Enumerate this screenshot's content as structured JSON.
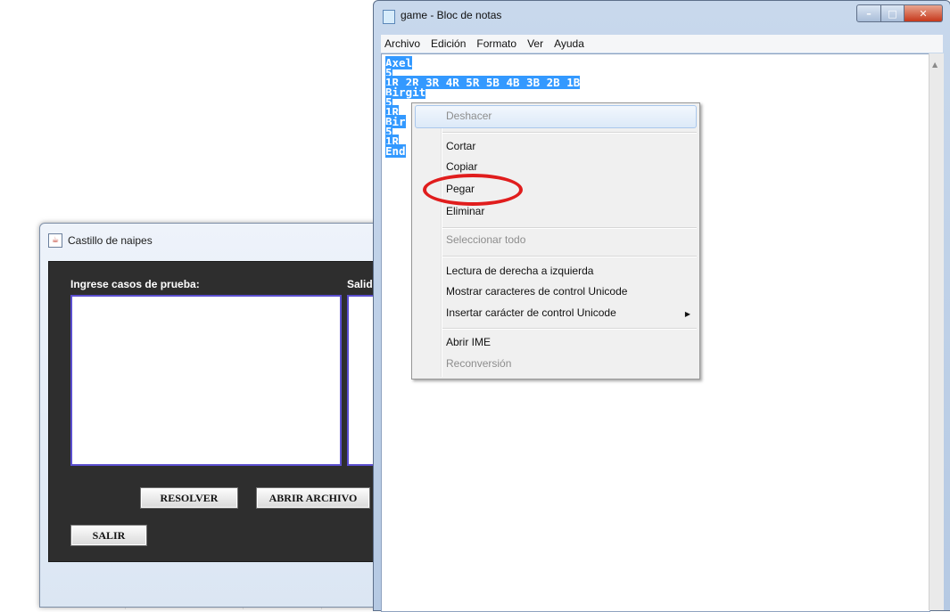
{
  "java_window": {
    "title": "Castillo de naipes",
    "input_label": "Ingrese casos de prueba:",
    "output_label": "Salid",
    "buttons": {
      "resolve": "RESOLVER",
      "open_file": "ABRIR ARCHIVO",
      "exit": "SALIR"
    }
  },
  "notepad": {
    "title": "game - Bloc de notas",
    "menu": [
      "Archivo",
      "Edición",
      "Formato",
      "Ver",
      "Ayuda"
    ],
    "lines": [
      "Axel",
      "5",
      "1R 2R 3R 4R 5R 5B 4B 3B 2B 1B",
      "Birgit",
      "5",
      "1R",
      "Bir",
      "5",
      "1R",
      "End"
    ]
  },
  "context_menu": {
    "undo": "Deshacer",
    "cut": "Cortar",
    "copy": "Copiar",
    "paste": "Pegar",
    "delete": "Eliminar",
    "select_all": "Seleccionar todo",
    "rtl": "Lectura de derecha a izquierda",
    "show_unicode": "Mostrar caracteres de control Unicode",
    "insert_unicode": "Insertar carácter de control Unicode",
    "open_ime": "Abrir IME",
    "reconversion": "Reconversión"
  },
  "colors": {
    "selection": "#3399ff",
    "annotation": "#e01d1d",
    "java_panel": "#2e2e2e"
  }
}
